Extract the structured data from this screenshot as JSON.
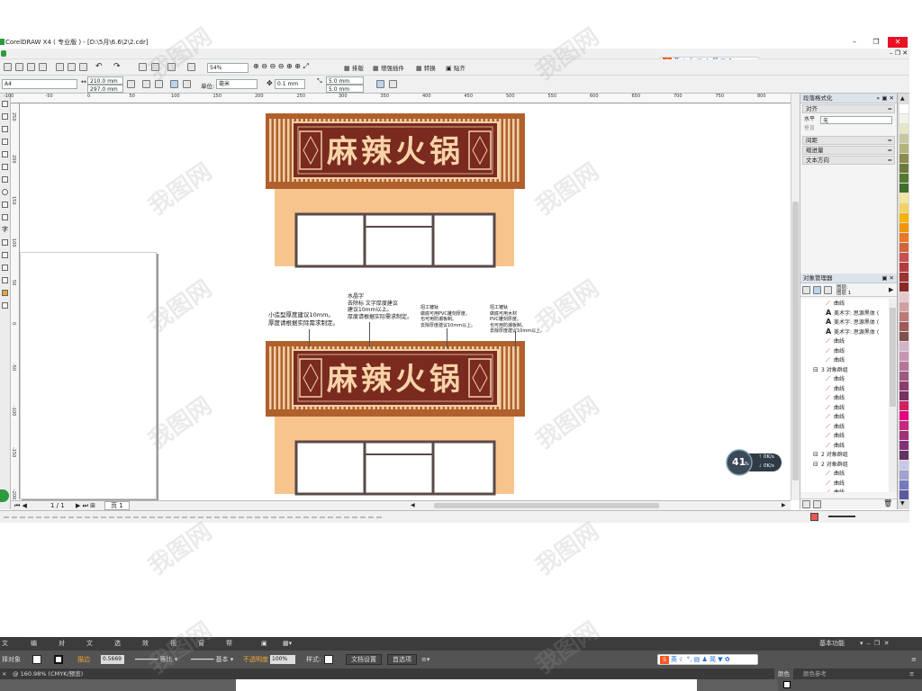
{
  "window": {
    "title": "CorelDRAW X4 ( 专业版 ) - [D:\\5月\\6.6\\2\\2.cdr]",
    "minimize": "–",
    "restore": "❐",
    "close": "✕"
  },
  "toolbar1": {
    "zoom_level": "54%",
    "buttons": [
      "排版",
      "增强插件",
      "转换",
      "贴齐"
    ]
  },
  "toolbar2": {
    "paper_size": "A4",
    "width": "210.0 mm",
    "height": "297.0 mm",
    "units_label": "单位:",
    "units_value": "毫米",
    "nudge": "0.1 mm",
    "dup_x": "5.0 mm",
    "dup_y": "5.0 mm"
  },
  "ime": {
    "lang": "英",
    "simp": "简",
    "symbols": [
      "♪",
      "°,",
      "▤",
      "👤",
      "👕",
      "✿"
    ]
  },
  "ruler": {
    "h_ticks": [
      "-100",
      "-50",
      "0",
      "50",
      "100",
      "150",
      "200",
      "250",
      "300",
      "350",
      "400",
      "450",
      "500",
      "550",
      "600",
      "650",
      "700",
      "750",
      "800",
      "850",
      "900",
      "950",
      "1000"
    ],
    "v_ticks": [
      "250",
      "200",
      "150",
      "100",
      "50",
      "0",
      "-50",
      "-100",
      "-150",
      "-200"
    ]
  },
  "storefront": {
    "sign_text": "麻辣火锅",
    "colors": {
      "frame": "#b0602c",
      "board": "#7a2a1f",
      "stripe_light": "#f0cfa6",
      "stripe_dark": "#9a4a2a",
      "text": "#f6d3a8",
      "wall": "#f7c48e",
      "door_frame": "#5a4a48"
    }
  },
  "notes": {
    "note1": "小造型厚度建议10mm。\n厚度请根据实际需求制定。",
    "note2": "水晶字\n去除标 文字厚度建议\n建议10mm以上。\n厚度请根据实际需求制定。",
    "note3": "招工镀钛\n做底可用PVC雕刻厚度。\n也可用防潮板制。\n去除厚度建议10mm以上。",
    "note4": "招工镀钛\n做底可用木材\nPVC雕刻厚度。\n也可用防潮板制。\n去除厚度建议10mm以上。"
  },
  "pagenav": {
    "page_count": "1 / 1",
    "page_tab": "页 1"
  },
  "docker": {
    "title": "段落格式化",
    "sections": {
      "align": "对齐",
      "horizontal_label": "水平",
      "horizontal_value": "无",
      "vertical_label": "垂直",
      "spacing": "间距",
      "indent": "缩进量",
      "text_direction": "文本方向"
    },
    "obj_manager": {
      "title": "对象管理器",
      "layer_lines": [
        "图层:",
        "图层 1"
      ],
      "items": [
        {
          "kind": "curve",
          "label": "曲线",
          "indent": 2
        },
        {
          "kind": "text",
          "label": "美术字: 思源黑体 (",
          "indent": 2
        },
        {
          "kind": "text",
          "label": "美术字: 思源黑体 (",
          "indent": 2
        },
        {
          "kind": "text",
          "label": "美术字: 思源黑体 (",
          "indent": 2
        },
        {
          "kind": "curve",
          "label": "曲线",
          "indent": 2
        },
        {
          "kind": "curve",
          "label": "曲线",
          "indent": 2
        },
        {
          "kind": "curve",
          "label": "曲线",
          "indent": 2
        },
        {
          "kind": "group",
          "label": "3 对象群组",
          "indent": 1
        },
        {
          "kind": "curve",
          "label": "曲线",
          "indent": 2
        },
        {
          "kind": "curve",
          "label": "曲线",
          "indent": 2
        },
        {
          "kind": "curve",
          "label": "曲线",
          "indent": 2
        },
        {
          "kind": "curve",
          "label": "曲线",
          "indent": 2
        },
        {
          "kind": "curve",
          "label": "曲线",
          "indent": 2
        },
        {
          "kind": "curve",
          "label": "曲线",
          "indent": 2
        },
        {
          "kind": "curve",
          "label": "曲线",
          "indent": 2
        },
        {
          "kind": "curve",
          "label": "曲线",
          "indent": 2
        },
        {
          "kind": "group",
          "label": "2 对象群组",
          "indent": 1
        },
        {
          "kind": "group",
          "label": "2 对象群组",
          "indent": 1
        },
        {
          "kind": "curve",
          "label": "曲线",
          "indent": 2
        },
        {
          "kind": "curve",
          "label": "曲线",
          "indent": 2
        },
        {
          "kind": "curve",
          "label": "曲线",
          "indent": 2
        }
      ]
    }
  },
  "palette": [
    "#ffffff",
    "#f2f2e6",
    "#e6e6c8",
    "#c8c8a0",
    "#b4b47a",
    "#8c8c50",
    "#6e7a3c",
    "#557a2f",
    "#3f6e2e",
    "#f2e6a0",
    "#f2d264",
    "#f2b400",
    "#f29600",
    "#e67828",
    "#d2643c",
    "#c85050",
    "#b43c3c",
    "#a03232",
    "#8c2828",
    "#e6c8c8",
    "#d2a0a0",
    "#be7878",
    "#a05a5a",
    "#825050",
    "#d2b4c8",
    "#c896b4",
    "#b4789b",
    "#a05a82",
    "#8c3c6e",
    "#783264",
    "#d21e64",
    "#e60082",
    "#c8287d",
    "#a03278",
    "#823278",
    "#643264",
    "#c8c8e6",
    "#a0a0d2",
    "#7878be",
    "#5a5aa0"
  ],
  "zoom_widget": {
    "percent": "41",
    "unit": "%",
    "up_rate": "0K/s",
    "down_rate": "0K/s"
  },
  "illustrator": {
    "menus": [
      "文件(F)",
      "编辑(E)",
      "对象(O)",
      "文字(T)",
      "选择(S)",
      "效果(C)",
      "视图(V)",
      "窗口(W)",
      "帮助(H)"
    ],
    "workspace": "基本功能",
    "ctl": {
      "no_selection": "择对象",
      "stroke_label": "描边",
      "stroke_value": "0.5669",
      "profile1": "等比",
      "profile2": "基本",
      "opacity_label": "不透明度",
      "opacity_value": "100%",
      "style_label": "样式:",
      "doc_setup": "文档设置",
      "prefs": "首选项"
    },
    "doc_tab": "@ 160.98% (CMYK/预览)",
    "panel_tabs": [
      "颜色",
      "颜色参考"
    ]
  },
  "watermark": "我图网"
}
